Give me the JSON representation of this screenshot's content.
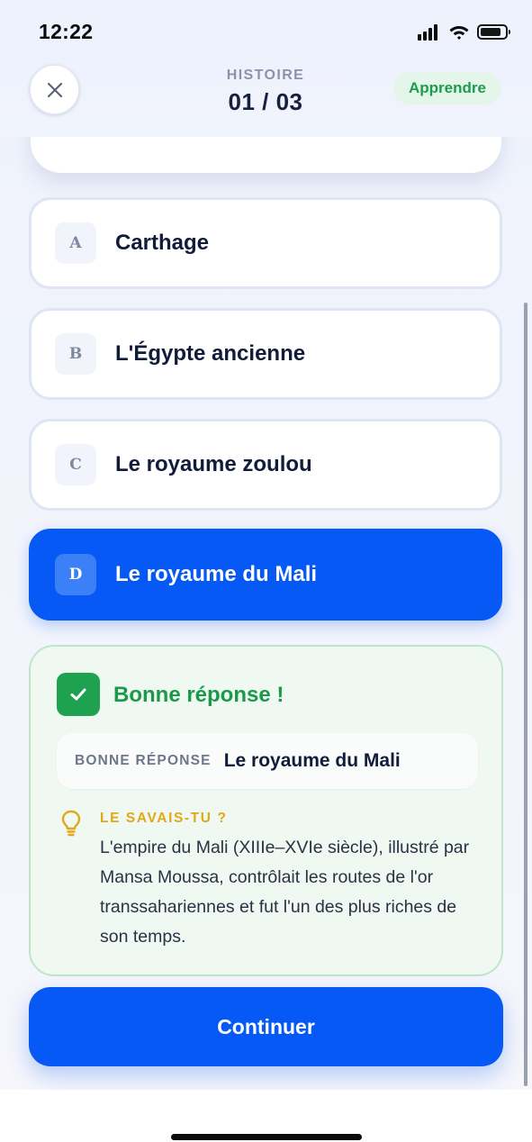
{
  "status_bar": {
    "time": "12:22"
  },
  "header": {
    "section": "HISTOIRE",
    "progress": "01 / 03",
    "learn_label": "Apprendre"
  },
  "options": [
    {
      "letter": "A",
      "label": "Carthage",
      "selected": false
    },
    {
      "letter": "B",
      "label": "L'Égypte ancienne",
      "selected": false
    },
    {
      "letter": "C",
      "label": "Le royaume zoulou",
      "selected": false
    },
    {
      "letter": "D",
      "label": "Le royaume du Mali",
      "selected": true
    }
  ],
  "feedback": {
    "title": "Bonne réponse !",
    "answer_key": "BONNE RÉPONSE",
    "answer_value": "Le royaume du Mali",
    "fact_title": "LE SAVAIS-TU ?",
    "fact_text": "L'empire du Mali (XIIIe–XVIe siècle), illustré par Mansa Moussa, contrôlait les routes de l'or transsahariennes et fut l'un des plus riches de son temps."
  },
  "continue_label": "Continuer",
  "colors": {
    "primary": "#0659f4",
    "success": "#1fa24f",
    "success_bg": "#eff8f1",
    "hint": "#e0a918"
  }
}
